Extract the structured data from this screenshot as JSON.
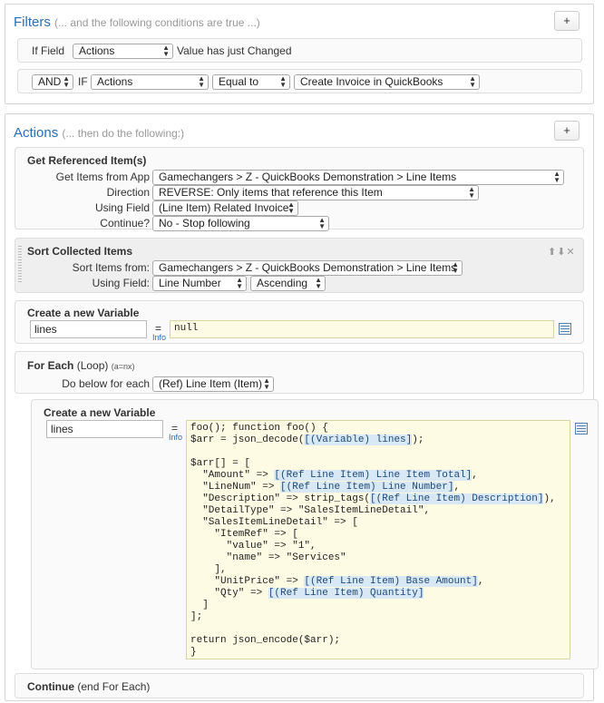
{
  "filters": {
    "title": "Filters",
    "subtitle": "(... and the following conditions are true ...)",
    "add_label": "+",
    "row1": {
      "prefix": "If Field",
      "field": "Actions",
      "suffix": "Value has just Changed"
    },
    "row2": {
      "op": "AND",
      "if_label": "IF",
      "field": "Actions",
      "comparator": "Equal to",
      "value": "Create Invoice in QuickBooks"
    }
  },
  "actions": {
    "title": "Actions",
    "subtitle": "(... then do the following:)",
    "add_label": "+",
    "get_ref": {
      "title": "Get Referenced Item(s)",
      "app_label": "Get Items from App",
      "app_value": "Gamechangers > Z - QuickBooks Demonstration > Line Items",
      "direction_label": "Direction",
      "direction_value": "REVERSE: Only items that reference this Item",
      "field_label": "Using Field",
      "field_value": "(Line Item) Related Invoice",
      "continue_label": "Continue?",
      "continue_value": "No - Stop following"
    },
    "sort": {
      "title": "Sort Collected Items",
      "from_label": "Sort Items from:",
      "from_value": "Gamechangers > Z - QuickBooks Demonstration > Line Items",
      "field_label": "Using Field:",
      "field_value": "Line Number",
      "order_value": "Ascending",
      "controls": "⬆⬇✕"
    },
    "var1": {
      "title": "Create a new Variable",
      "name": "lines",
      "eq": "=",
      "info": "Info",
      "value": "null"
    },
    "foreach": {
      "title": "For Each",
      "title_suffix": "(Loop)",
      "hint": "(a=nx)",
      "below_label": "Do below for each",
      "below_value": "(Ref) Line Item (Item)"
    },
    "var2": {
      "title": "Create a new Variable",
      "name": "lines",
      "eq": "=",
      "info": "Info",
      "code_lines": [
        "foo(); function foo() {",
        "$arr = json_decode([(Variable) lines]);",
        "",
        "$arr[] = [",
        "  \"Amount\" => [(Ref Line Item) Line Item Total],",
        "  \"LineNum\" => [(Ref Line Item) Line Number],",
        "  \"Description\" => strip_tags([(Ref Line Item) Description]),",
        "  \"DetailType\" => \"SalesItemLineDetail\",",
        "  \"SalesItemLineDetail\" => [",
        "    \"ItemRef\" => [",
        "      \"value\" => \"1\",",
        "      \"name\" => \"Services\"",
        "    ],",
        "    \"UnitPrice\" => [(Ref Line Item) Base Amount],",
        "    \"Qty\" => [(Ref Line Item) Quantity]",
        "  ]",
        "];",
        "",
        "return json_encode($arr);",
        "}"
      ]
    },
    "continue": {
      "title": "Continue",
      "suffix": "(end For Each)"
    }
  }
}
